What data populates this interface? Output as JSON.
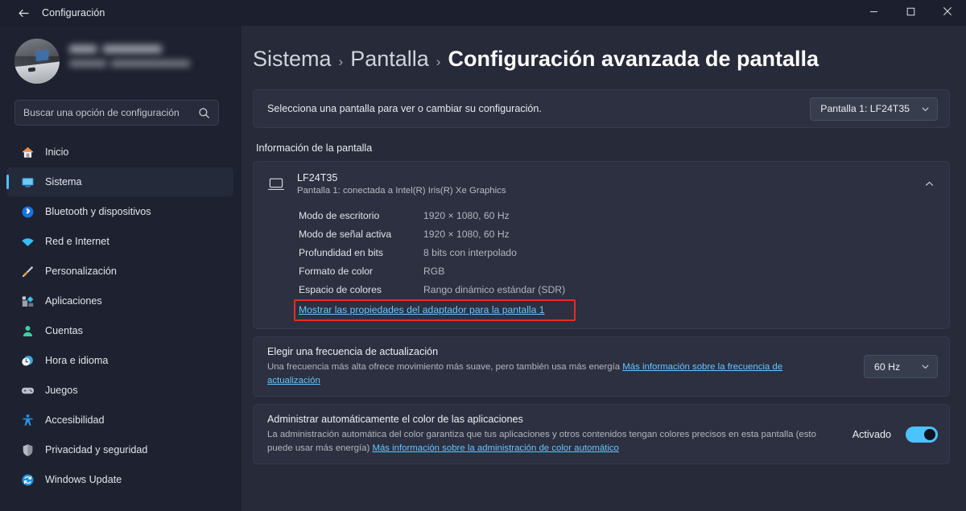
{
  "window": {
    "title": "Configuración",
    "back_icon": "back-arrow-icon",
    "minimize_label": "—",
    "maximize_label": "▢",
    "close_label": "✕"
  },
  "sidebar": {
    "profile": {
      "name": "",
      "email": "",
      "avatar_alt": "user-avatar"
    },
    "search": {
      "placeholder": "Buscar una opción de configuración",
      "value": "",
      "icon": "search-icon"
    },
    "items": [
      {
        "label": "Inicio",
        "icon": "home-icon",
        "selected": false
      },
      {
        "label": "Sistema",
        "icon": "system-monitor-icon",
        "selected": true
      },
      {
        "label": "Bluetooth y dispositivos",
        "icon": "bluetooth-icon",
        "selected": false
      },
      {
        "label": "Red e Internet",
        "icon": "wifi-icon",
        "selected": false
      },
      {
        "label": "Personalización",
        "icon": "paintbrush-icon",
        "selected": false
      },
      {
        "label": "Aplicaciones",
        "icon": "apps-icon",
        "selected": false
      },
      {
        "label": "Cuentas",
        "icon": "account-person-icon",
        "selected": false
      },
      {
        "label": "Hora e idioma",
        "icon": "clock-icon",
        "selected": false
      },
      {
        "label": "Juegos",
        "icon": "gamepad-icon",
        "selected": false
      },
      {
        "label": "Accesibilidad",
        "icon": "accessibility-icon",
        "selected": false
      },
      {
        "label": "Privacidad y seguridad",
        "icon": "shield-icon",
        "selected": false
      },
      {
        "label": "Windows Update",
        "icon": "update-refresh-icon",
        "selected": false
      }
    ]
  },
  "breadcrumb": {
    "crumb1": "Sistema",
    "sep1": "›",
    "crumb2": "Pantalla",
    "sep2": "›",
    "current": "Configuración avanzada de pantalla"
  },
  "display_picker": {
    "label": "Selecciona una pantalla para ver o cambiar su configuración.",
    "selected": "Pantalla 1: LF24T35",
    "chevron": "chevron-down-icon"
  },
  "display_info": {
    "section_title": "Información de la pantalla",
    "monitor_icon": "monitor-icon",
    "name": "LF24T35",
    "connection": "Pantalla 1: conectada a Intel(R) Iris(R) Xe Graphics",
    "expander_icon": "chevron-up-icon",
    "rows": [
      {
        "key": "Modo de escritorio",
        "value": "1920 × 1080, 60 Hz"
      },
      {
        "key": "Modo de señal activa",
        "value": "1920 × 1080, 60 Hz"
      },
      {
        "key": "Profundidad en bits",
        "value": "8 bits con interpolado"
      },
      {
        "key": "Formato de color",
        "value": "RGB"
      },
      {
        "key": "Espacio de colores",
        "value": "Rango dinámico estándar (SDR)"
      }
    ],
    "adapter_link": "Mostrar las propiedades del adaptador para la pantalla 1",
    "highlight_color": "#ef2a1f"
  },
  "refresh_rate": {
    "title": "Elegir una frecuencia de actualización",
    "desc": "Una frecuencia más alta ofrece movimiento más suave, pero también usa más energía",
    "link": "Más información sobre la frecuencia de actualización",
    "selected": "60 Hz",
    "chevron": "chevron-down-icon"
  },
  "auto_color": {
    "title": "Administrar automáticamente el color de las aplicaciones",
    "desc": "La administración automática del color garantiza que tus aplicaciones y otros contenidos tengan colores precisos en esta pantalla (esto puede usar más energía)",
    "link": "Más información sobre la administración de color automático",
    "toggle_label": "Activado",
    "toggle_on": true
  },
  "colors": {
    "accent": "#4cc2ff",
    "link": "#62c8ff",
    "sidebar_bg": "#1d2130",
    "main_bg": "#262a39",
    "card_bg": "#2c3040"
  }
}
